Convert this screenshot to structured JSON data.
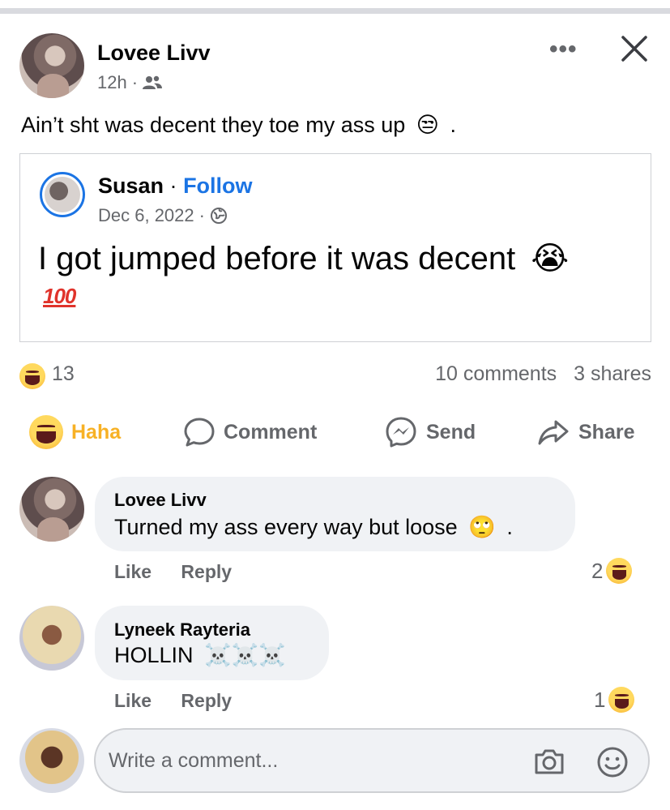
{
  "post": {
    "author": "Lovee Livv",
    "time": "12h",
    "meta_sep": "·",
    "text": "Ain’t sht was decent they toe my ass up",
    "text_emoji": "😒",
    "text_tail": "."
  },
  "shared_post": {
    "author": "Susan",
    "sep": "·",
    "follow_label": "Follow",
    "date": "Dec 6, 2022",
    "meta_sep": "·",
    "text": "I got jumped before it was decent",
    "text_emoji": "😭",
    "hundred": "100"
  },
  "stats": {
    "reaction_count": "13",
    "comments": "10 comments",
    "shares": "3 shares"
  },
  "actions": {
    "haha": "Haha",
    "comment": "Comment",
    "send": "Send",
    "share": "Share"
  },
  "comments": [
    {
      "author": "Lovee Livv",
      "text": "Turned my ass every way but loose",
      "emoji": "🙄",
      "tail": ".",
      "like": "Like",
      "reply": "Reply",
      "reaction_count": "2"
    },
    {
      "author": "Lyneek Rayteria",
      "text": "HOLLIN",
      "emoji": "☠️☠️☠️",
      "like": "Like",
      "reply": "Reply",
      "reaction_count": "1"
    }
  ],
  "composer": {
    "placeholder": "Write a comment..."
  },
  "colors": {
    "link_blue": "#1b74e4",
    "haha_yellow": "#f7b125",
    "secondary_text": "#65676b",
    "bubble_bg": "#f0f2f5"
  },
  "icons": [
    "friends-icon",
    "more-icon",
    "close-icon",
    "globe-icon",
    "haha-icon",
    "comment-icon",
    "messenger-icon",
    "share-icon",
    "camera-icon",
    "emoji-icon"
  ]
}
